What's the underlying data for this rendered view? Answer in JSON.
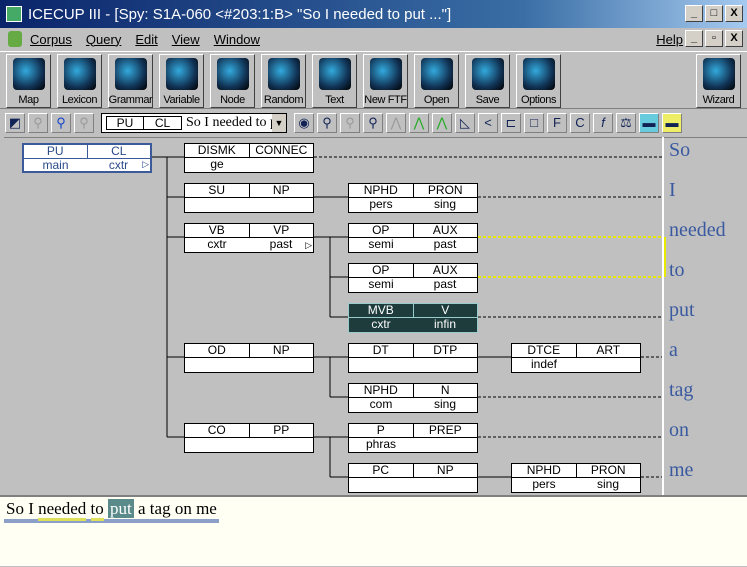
{
  "window": {
    "title": "ICECUP III - [Spy: S1A-060 <#203:1:B> \"So I needed to put ...\"]",
    "controls": [
      "_",
      "□",
      "X"
    ]
  },
  "menu": {
    "items": [
      "Corpus",
      "Query",
      "Edit",
      "View",
      "Window"
    ],
    "help": "Help",
    "controls": [
      "_",
      "▫",
      "X"
    ]
  },
  "toolbar": {
    "buttons": [
      "Map",
      "Lexicon",
      "Grammar",
      "Variable",
      "Node",
      "Random",
      "Text",
      "New FTF",
      "Open",
      "Save",
      "Options"
    ],
    "wizard": "Wizard"
  },
  "toolbar2": {
    "combo": {
      "function": "PU",
      "category": "CL",
      "text": "So I needed to put a tag on me"
    }
  },
  "tree": {
    "f": "PU",
    "c": "CL",
    "a": [
      "main",
      "cxtr"
    ],
    "selected": true,
    "more": true,
    "children": [
      {
        "f": "DISMK",
        "c": "CONNEC",
        "a": [
          "ge",
          ""
        ],
        "word": "So"
      },
      {
        "f": "SU",
        "c": "NP",
        "a": [
          "",
          ""
        ],
        "children": [
          {
            "f": "NPHD",
            "c": "PRON",
            "a": [
              "pers",
              "sing"
            ],
            "word": "I"
          }
        ]
      },
      {
        "f": "VB",
        "c": "VP",
        "a": [
          "cxtr",
          "past"
        ],
        "more": true,
        "children": [
          {
            "f": "OP",
            "c": "AUX",
            "a": [
              "semi",
              "past"
            ],
            "word": "needed",
            "linked": true
          },
          {
            "f": "OP",
            "c": "AUX",
            "a": [
              "semi",
              "past"
            ],
            "word": "to",
            "linked": true
          },
          {
            "f": "MVB",
            "c": "V",
            "a": [
              "cxtr",
              "infin"
            ],
            "word": "put",
            "focus": true
          }
        ]
      },
      {
        "f": "OD",
        "c": "NP",
        "a": [
          "",
          ""
        ],
        "children": [
          {
            "f": "DT",
            "c": "DTP",
            "a": [
              "",
              ""
            ],
            "children": [
              {
                "f": "DTCE",
                "c": "ART",
                "a": [
                  "indef",
                  ""
                ],
                "word": "a"
              }
            ]
          },
          {
            "f": "NPHD",
            "c": "N",
            "a": [
              "com",
              "sing"
            ],
            "word": "tag"
          }
        ]
      },
      {
        "f": "CO",
        "c": "PP",
        "a": [
          "",
          ""
        ],
        "children": [
          {
            "f": "P",
            "c": "PREP",
            "a": [
              "phras",
              ""
            ],
            "word": "on"
          },
          {
            "f": "PC",
            "c": "NP",
            "a": [
              "",
              ""
            ],
            "children": [
              {
                "f": "NPHD",
                "c": "PRON",
                "a": [
                  "pers",
                  "sing"
                ],
                "word": "me"
              }
            ]
          }
        ]
      }
    ]
  },
  "sentence": {
    "words": [
      "So",
      "I",
      "needed",
      "to",
      "put",
      "a",
      "tag",
      "on",
      "me"
    ]
  },
  "colors": {
    "link": "#e8e800",
    "focus": "#1e3c3c",
    "word": "#3a5aa0"
  }
}
